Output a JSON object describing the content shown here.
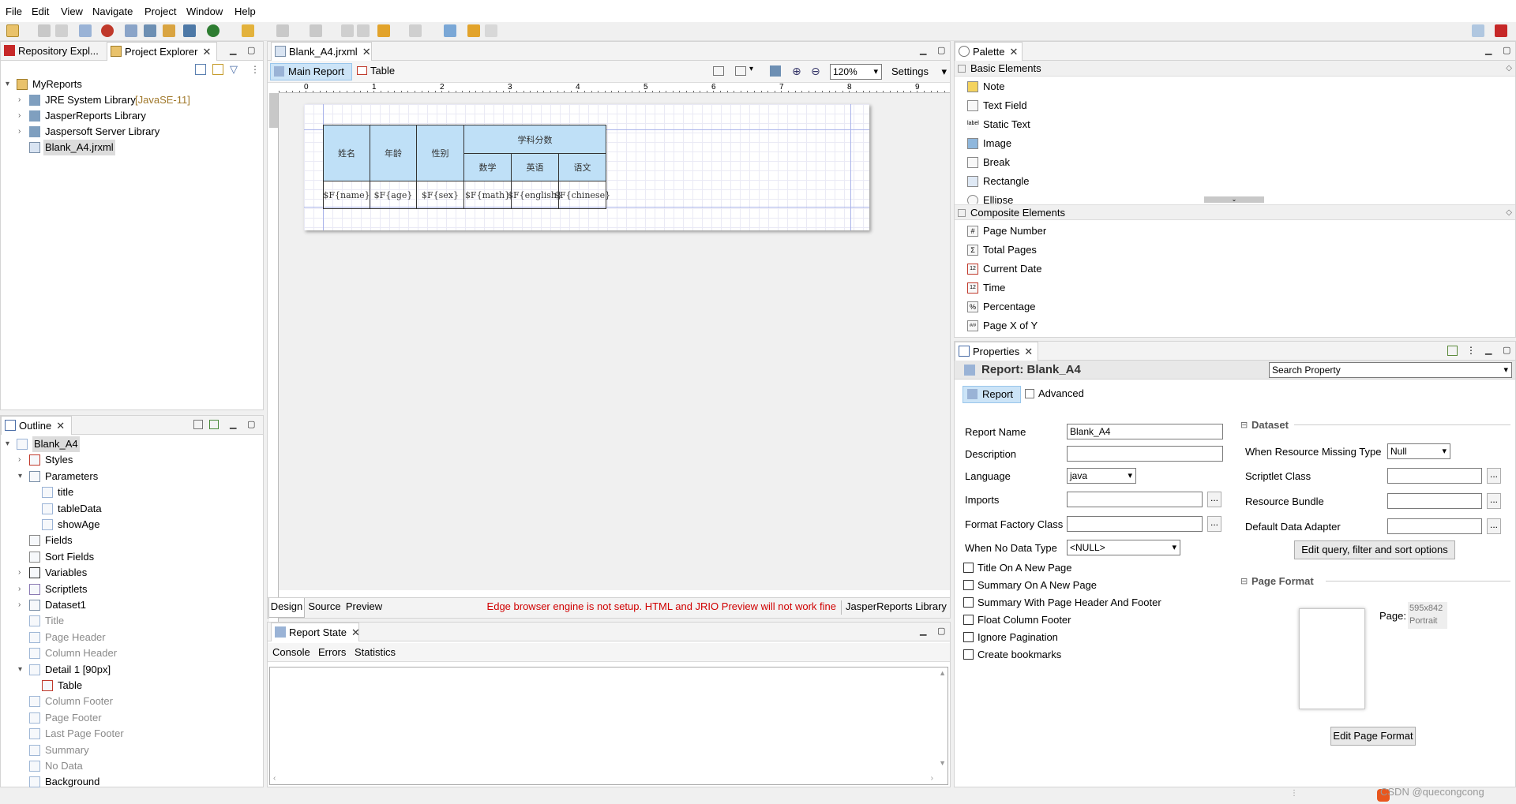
{
  "menu": [
    "File",
    "Edit",
    "View",
    "Navigate",
    "Project",
    "Window",
    "Help"
  ],
  "left_top": {
    "tabs": [
      "Repository Expl...",
      "Project Explorer"
    ],
    "tree": [
      {
        "label": "MyReports",
        "extra": ""
      },
      {
        "label": "JRE System Library",
        "extra": "[JavaSE-11]"
      },
      {
        "label": "JasperReports Library",
        "extra": ""
      },
      {
        "label": "Jaspersoft Server Library",
        "extra": ""
      },
      {
        "label": "Blank_A4.jrxml",
        "extra": ""
      }
    ]
  },
  "outline": {
    "tab": "Outline",
    "items": [
      {
        "label": "Blank_A4"
      },
      {
        "label": "Styles"
      },
      {
        "label": "Parameters"
      },
      {
        "label": "title"
      },
      {
        "label": "tableData"
      },
      {
        "label": "showAge"
      },
      {
        "label": "Fields"
      },
      {
        "label": "Sort Fields"
      },
      {
        "label": "Variables"
      },
      {
        "label": "Scriptlets"
      },
      {
        "label": "Dataset1"
      },
      {
        "label": "Title"
      },
      {
        "label": "Page Header"
      },
      {
        "label": "Column Header"
      },
      {
        "label": "Detail 1 [90px]"
      },
      {
        "label": "Table"
      },
      {
        "label": "Column Footer"
      },
      {
        "label": "Page Footer"
      },
      {
        "label": "Last Page Footer"
      },
      {
        "label": "Summary"
      },
      {
        "label": "No Data"
      },
      {
        "label": "Background"
      }
    ]
  },
  "editor": {
    "tab": "Blank_A4.jrxml",
    "subtabs": [
      "Main Report",
      "Table"
    ],
    "zoom": "120%",
    "settings": "Settings",
    "ruler": [
      "0",
      "1",
      "2",
      "3",
      "4",
      "5",
      "6",
      "7",
      "8",
      "9"
    ],
    "table": {
      "group_header": "学科分数",
      "h1": "姓名",
      "h2": "年龄",
      "h3": "性别",
      "sub": [
        "数学",
        "英语",
        "语文"
      ],
      "fields": [
        "$F{name}",
        "$F{age}",
        "$F{sex}",
        "$F{math}",
        "$F{english}",
        "$F{chinese}"
      ]
    },
    "bottom_tabs": [
      "Design",
      "Source",
      "Preview"
    ],
    "warning": "Edge browser engine is not setup. HTML and JRIO Preview will not work fine",
    "library": "JasperReports Library"
  },
  "report_state": {
    "tab": "Report State",
    "subtabs": [
      "Console",
      "Errors",
      "Statistics"
    ]
  },
  "palette": {
    "tab": "Palette",
    "basic_title": "Basic Elements",
    "basic": [
      "Note",
      "Text Field",
      "Static Text",
      "Image",
      "Break",
      "Rectangle",
      "Ellipse"
    ],
    "composite_title": "Composite Elements",
    "composite": [
      {
        "icon": "#",
        "label": "Page Number"
      },
      {
        "icon": "Σ",
        "label": "Total Pages"
      },
      {
        "icon": "12",
        "label": "Current Date"
      },
      {
        "icon": "12",
        "label": "Time"
      },
      {
        "icon": "%",
        "label": "Percentage"
      },
      {
        "icon": "#/#",
        "label": "Page X of Y"
      }
    ]
  },
  "properties": {
    "tab": "Properties",
    "title": "Report: Blank_A4",
    "search": "Search Property",
    "subtabs": [
      "Report",
      "Advanced"
    ],
    "report_name_label": "Report Name",
    "report_name": "Blank_A4",
    "description_label": "Description",
    "description": "",
    "language_label": "Language",
    "language": "java",
    "imports_label": "Imports",
    "format_factory_label": "Format Factory Class",
    "no_data_label": "When No Data Type",
    "no_data": "<NULL>",
    "checks": [
      "Title On A New Page",
      "Summary On A New Page",
      "Summary With Page Header And Footer",
      "Float Column Footer",
      "Ignore Pagination",
      "Create bookmarks"
    ],
    "dataset_title": "Dataset",
    "resource_missing_label": "When Resource Missing Type",
    "resource_missing": "Null",
    "scriptlet_label": "Scriptlet Class",
    "bundle_label": "Resource Bundle",
    "adapter_label": "Default Data Adapter",
    "edit_query": "Edit query, filter and sort options",
    "page_format_title": "Page Format",
    "page_label": "Page:",
    "page_size": "595x842",
    "orientation": "Portrait",
    "edit_page_format": "Edit Page Format"
  },
  "watermark": "CSDN @quecongcong",
  "colors": {
    "accent": "#c62828",
    "header_cell": "#bfe0f7",
    "selection": "#cce4f7",
    "warning": "#d00000"
  }
}
